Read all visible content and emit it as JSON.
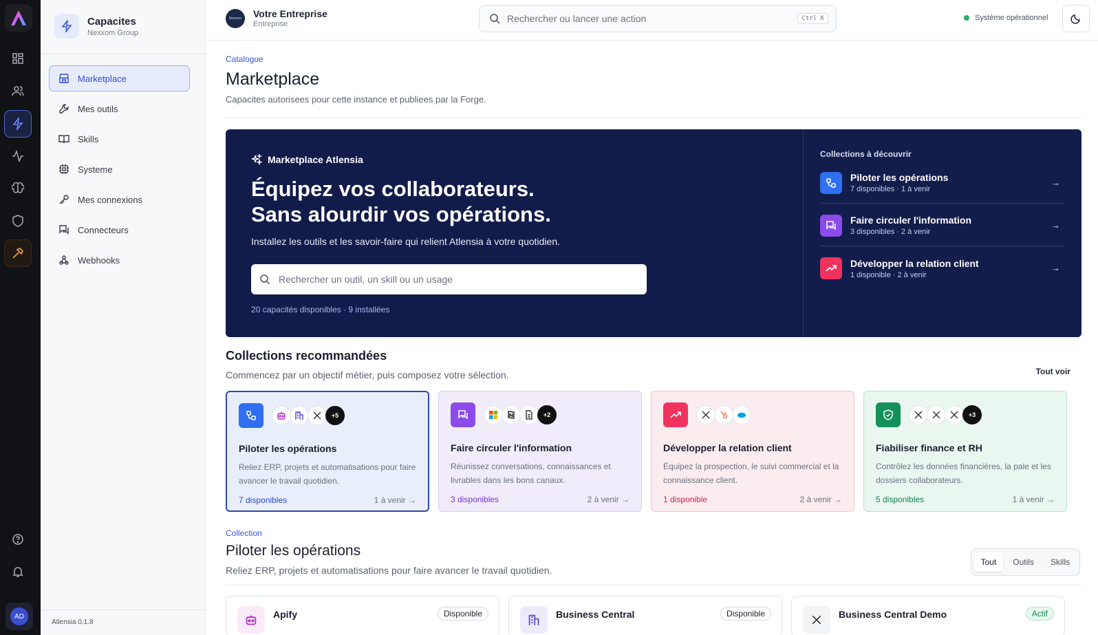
{
  "sidebar": {
    "brand_title": "Capacites",
    "brand_subtitle": "Nexxom Group",
    "items": [
      {
        "label": "Marketplace",
        "icon": "store-icon"
      },
      {
        "label": "Mes outils",
        "icon": "wrench-icon"
      },
      {
        "label": "Skills",
        "icon": "book-icon"
      },
      {
        "label": "Systeme",
        "icon": "chip-icon"
      },
      {
        "label": "Mes connexions",
        "icon": "key-icon"
      },
      {
        "label": "Connecteurs",
        "icon": "chat-plug-icon"
      },
      {
        "label": "Webhooks",
        "icon": "webhook-icon"
      }
    ],
    "version": "Atlensia 0.1.8"
  },
  "rail": {
    "avatar_initials": "AD"
  },
  "topbar": {
    "company_name": "Votre Entreprise",
    "company_type": "Entreprise",
    "company_logo_text": "Nexxom",
    "search_placeholder": "Rechercher ou lancer une action",
    "search_shortcut": "Ctrl K",
    "status_text": "Système opérationnel"
  },
  "page": {
    "breadcrumb": "Catalogue",
    "title": "Marketplace",
    "subtitle": "Capacites autorisees pour cette instance et publiees par la Forge."
  },
  "hero": {
    "tag": "Marketplace Atlensia",
    "headline_line1": "Équipez vos collaborateurs.",
    "headline_line2": "Sans alourdir vos opérations.",
    "description": "Installez les outils et les savoir-faire qui relient Atlensia à votre quotidien.",
    "search_placeholder": "Rechercher un outil, un skill ou un usage",
    "counts": "20 capacités disponibles · 9 installées",
    "collections_heading": "Collections à découvrir",
    "collections": [
      {
        "title": "Piloter les opérations",
        "stats": "7 disponibles · 1 à venir",
        "color": "#2f6ff0"
      },
      {
        "title": "Faire circuler l'information",
        "stats": "3 disponibles · 2 à venir",
        "color": "#8b4bea"
      },
      {
        "title": "Développer la relation client",
        "stats": "1 disponible · 2 à venir",
        "color": "#f0335e"
      }
    ]
  },
  "recommended": {
    "title": "Collections recommandées",
    "subtitle": "Commencez par un objectif métier, puis composez votre sélection.",
    "see_all": "Tout voir",
    "cards": [
      {
        "title": "Piloter les opérations",
        "description": "Reliez ERP, projets et automatisations pour faire avancer le travail quotidien.",
        "available": "7 disponibles",
        "soon": "1 à venir",
        "more": "+5",
        "accent": "#2f6ff0",
        "bg": "#e9eefb",
        "border": "#2e49b8",
        "text": "#2a46c6"
      },
      {
        "title": "Faire circuler l'information",
        "description": "Réunissez conversations, connaissances et livrables dans les bons canaux.",
        "available": "3 disponibles",
        "soon": "2 à venir",
        "more": "+2",
        "accent": "#8b4bea",
        "bg": "#f0ecfa",
        "border": "#d9cdf3",
        "text": "#7a2fd6"
      },
      {
        "title": "Développer la relation client",
        "description": "Équipez la prospection, le suivi commercial et la connaissance client.",
        "available": "1 disponible",
        "soon": "2 à venir",
        "more": "",
        "accent": "#f0335e",
        "bg": "#fbecef",
        "border": "#f2c5cf",
        "text": "#d81e4a"
      },
      {
        "title": "Fiabiliser finance et RH",
        "description": "Contrôlez les données financières, la paie et les dossiers collaborateurs.",
        "available": "5 disponibles",
        "soon": "1 à venir",
        "more": "+3",
        "accent": "#14915a",
        "bg": "#eaf6f0",
        "border": "#bfe3d0",
        "text": "#12804f"
      }
    ]
  },
  "collection": {
    "breadcrumb": "Collection",
    "title": "Piloter les opérations",
    "subtitle": "Reliez ERP, projets et automatisations pour faire avancer le travail quotidien.",
    "filters": [
      "Tout",
      "Outils",
      "Skills"
    ],
    "tools": [
      {
        "name": "Apify",
        "status": "Disponible"
      },
      {
        "name": "Business Central",
        "status": "Disponible"
      },
      {
        "name": "Business Central Demo",
        "status": "Actif"
      }
    ]
  }
}
